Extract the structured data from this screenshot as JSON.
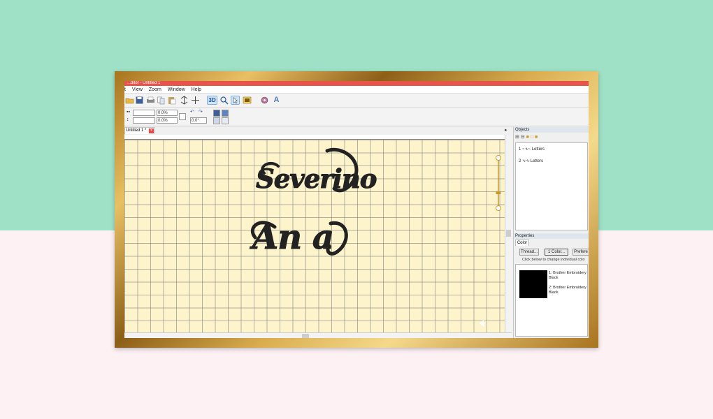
{
  "window": {
    "title": "...ditor - Untitled 1"
  },
  "menu": {
    "items": [
      "t",
      "View",
      "Zoom",
      "Window",
      "Help"
    ]
  },
  "toolbar": {
    "icons": [
      "open-icon",
      "save-icon",
      "print-icon",
      "copy-icon",
      "paste-icon",
      "flip-icon",
      "mirror-icon",
      "3d-view-icon",
      "zoom-icon",
      "select-icon",
      "image-icon",
      "stitch-icon",
      "text-icon"
    ],
    "three_d_label": "3D",
    "text_tool_label": "A"
  },
  "properties_bar": {
    "width_value": "",
    "height_value": "",
    "width_percent": "0.0%",
    "height_percent": "0.0%",
    "rotate_value": "0.0°"
  },
  "document": {
    "tab_label": "Untitled 1 *",
    "tab_close": "x"
  },
  "design": {
    "name_line1": "Severino",
    "name_line2": "An a",
    "color": "#222222"
  },
  "objects_panel": {
    "header": "Objects",
    "items": [
      {
        "label": "1",
        "type": "Letters"
      },
      {
        "label": "2",
        "type": "Letters"
      }
    ]
  },
  "properties_panel": {
    "header": "Properties",
    "tab_color": "Color",
    "thread_button": "Thread...",
    "color_count_button": "1 Color...",
    "preference_button": "Prefere",
    "hint": "Click below to change individual colo",
    "thread_colors": [
      {
        "line1": "1: Brother Embroidery",
        "line2": "Black",
        "hex": "#000000"
      },
      {
        "line1": "2: Brother Embroidery",
        "line2": "Black",
        "hex": "#000000"
      }
    ]
  },
  "colors": {
    "bg_top": "#9fe1c6",
    "bg_bottom": "#fdf1f4",
    "frame_gold": "#c9992f",
    "title_red": "#e8534a",
    "canvas": "#fdf4cc"
  }
}
